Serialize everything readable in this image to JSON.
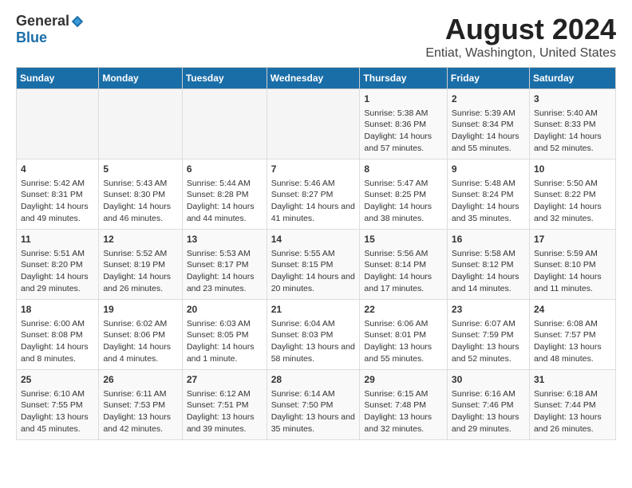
{
  "header": {
    "logo_general": "General",
    "logo_blue": "Blue",
    "title": "August 2024",
    "subtitle": "Entiat, Washington, United States"
  },
  "days_of_week": [
    "Sunday",
    "Monday",
    "Tuesday",
    "Wednesday",
    "Thursday",
    "Friday",
    "Saturday"
  ],
  "weeks": [
    [
      {
        "day": "",
        "content": ""
      },
      {
        "day": "",
        "content": ""
      },
      {
        "day": "",
        "content": ""
      },
      {
        "day": "",
        "content": ""
      },
      {
        "day": "1",
        "content": "Sunrise: 5:38 AM\nSunset: 8:36 PM\nDaylight: 14 hours and 57 minutes."
      },
      {
        "day": "2",
        "content": "Sunrise: 5:39 AM\nSunset: 8:34 PM\nDaylight: 14 hours and 55 minutes."
      },
      {
        "day": "3",
        "content": "Sunrise: 5:40 AM\nSunset: 8:33 PM\nDaylight: 14 hours and 52 minutes."
      }
    ],
    [
      {
        "day": "4",
        "content": "Sunrise: 5:42 AM\nSunset: 8:31 PM\nDaylight: 14 hours and 49 minutes."
      },
      {
        "day": "5",
        "content": "Sunrise: 5:43 AM\nSunset: 8:30 PM\nDaylight: 14 hours and 46 minutes."
      },
      {
        "day": "6",
        "content": "Sunrise: 5:44 AM\nSunset: 8:28 PM\nDaylight: 14 hours and 44 minutes."
      },
      {
        "day": "7",
        "content": "Sunrise: 5:46 AM\nSunset: 8:27 PM\nDaylight: 14 hours and 41 minutes."
      },
      {
        "day": "8",
        "content": "Sunrise: 5:47 AM\nSunset: 8:25 PM\nDaylight: 14 hours and 38 minutes."
      },
      {
        "day": "9",
        "content": "Sunrise: 5:48 AM\nSunset: 8:24 PM\nDaylight: 14 hours and 35 minutes."
      },
      {
        "day": "10",
        "content": "Sunrise: 5:50 AM\nSunset: 8:22 PM\nDaylight: 14 hours and 32 minutes."
      }
    ],
    [
      {
        "day": "11",
        "content": "Sunrise: 5:51 AM\nSunset: 8:20 PM\nDaylight: 14 hours and 29 minutes."
      },
      {
        "day": "12",
        "content": "Sunrise: 5:52 AM\nSunset: 8:19 PM\nDaylight: 14 hours and 26 minutes."
      },
      {
        "day": "13",
        "content": "Sunrise: 5:53 AM\nSunset: 8:17 PM\nDaylight: 14 hours and 23 minutes."
      },
      {
        "day": "14",
        "content": "Sunrise: 5:55 AM\nSunset: 8:15 PM\nDaylight: 14 hours and 20 minutes."
      },
      {
        "day": "15",
        "content": "Sunrise: 5:56 AM\nSunset: 8:14 PM\nDaylight: 14 hours and 17 minutes."
      },
      {
        "day": "16",
        "content": "Sunrise: 5:58 AM\nSunset: 8:12 PM\nDaylight: 14 hours and 14 minutes."
      },
      {
        "day": "17",
        "content": "Sunrise: 5:59 AM\nSunset: 8:10 PM\nDaylight: 14 hours and 11 minutes."
      }
    ],
    [
      {
        "day": "18",
        "content": "Sunrise: 6:00 AM\nSunset: 8:08 PM\nDaylight: 14 hours and 8 minutes."
      },
      {
        "day": "19",
        "content": "Sunrise: 6:02 AM\nSunset: 8:06 PM\nDaylight: 14 hours and 4 minutes."
      },
      {
        "day": "20",
        "content": "Sunrise: 6:03 AM\nSunset: 8:05 PM\nDaylight: 14 hours and 1 minute."
      },
      {
        "day": "21",
        "content": "Sunrise: 6:04 AM\nSunset: 8:03 PM\nDaylight: 13 hours and 58 minutes."
      },
      {
        "day": "22",
        "content": "Sunrise: 6:06 AM\nSunset: 8:01 PM\nDaylight: 13 hours and 55 minutes."
      },
      {
        "day": "23",
        "content": "Sunrise: 6:07 AM\nSunset: 7:59 PM\nDaylight: 13 hours and 52 minutes."
      },
      {
        "day": "24",
        "content": "Sunrise: 6:08 AM\nSunset: 7:57 PM\nDaylight: 13 hours and 48 minutes."
      }
    ],
    [
      {
        "day": "25",
        "content": "Sunrise: 6:10 AM\nSunset: 7:55 PM\nDaylight: 13 hours and 45 minutes."
      },
      {
        "day": "26",
        "content": "Sunrise: 6:11 AM\nSunset: 7:53 PM\nDaylight: 13 hours and 42 minutes."
      },
      {
        "day": "27",
        "content": "Sunrise: 6:12 AM\nSunset: 7:51 PM\nDaylight: 13 hours and 39 minutes."
      },
      {
        "day": "28",
        "content": "Sunrise: 6:14 AM\nSunset: 7:50 PM\nDaylight: 13 hours and 35 minutes."
      },
      {
        "day": "29",
        "content": "Sunrise: 6:15 AM\nSunset: 7:48 PM\nDaylight: 13 hours and 32 minutes."
      },
      {
        "day": "30",
        "content": "Sunrise: 6:16 AM\nSunset: 7:46 PM\nDaylight: 13 hours and 29 minutes."
      },
      {
        "day": "31",
        "content": "Sunrise: 6:18 AM\nSunset: 7:44 PM\nDaylight: 13 hours and 26 minutes."
      }
    ]
  ]
}
